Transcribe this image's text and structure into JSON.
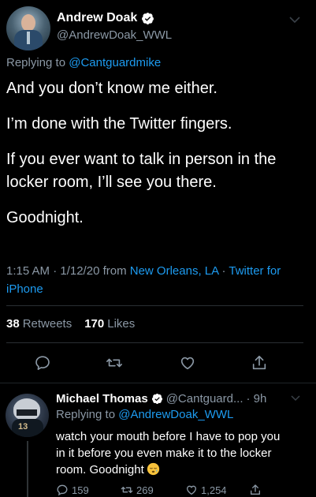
{
  "main_tweet": {
    "author_name": "Andrew Doak",
    "author_handle": "@AndrewDoak_WWL",
    "replying_prefix": "Replying to",
    "replying_to": "@Cantguardmike",
    "lines": [
      "And you don’t know me either.",
      "I’m done with the Twitter fingers.",
      "If you ever want to talk in person in the locker room, I’ll see you there.",
      "Goodnight."
    ],
    "time": "1:15 AM · 1/12/20 from ",
    "location": "New Orleans, LA",
    "separator": " · ",
    "source": "Twitter for iPhone",
    "retweets_count": "38",
    "retweets_label": "Retweets",
    "likes_count": "170",
    "likes_label": "Likes"
  },
  "reply_tweet": {
    "author_name": "Michael Thomas",
    "author_handle": "@Cantguard...",
    "age": "· 9h",
    "replying_prefix": "Replying to",
    "replying_to": "@AndrewDoak_WWL",
    "text": "watch your mouth before I have to pop you in it before you even make it to the locker room. Goodnight",
    "jersey_number": "13",
    "reply_count": "159",
    "retweet_count": "269",
    "like_count": "1,254"
  },
  "colors": {
    "background": "#000000",
    "text": "#ffffff",
    "secondary": "#8b98a5",
    "accent": "#1d9bf0",
    "divider": "#2a2f33"
  },
  "icons": [
    "verified-badge-icon",
    "chevron-down-icon",
    "reply-icon",
    "retweet-icon",
    "like-icon",
    "share-icon",
    "sleepy-face-emoji"
  ]
}
